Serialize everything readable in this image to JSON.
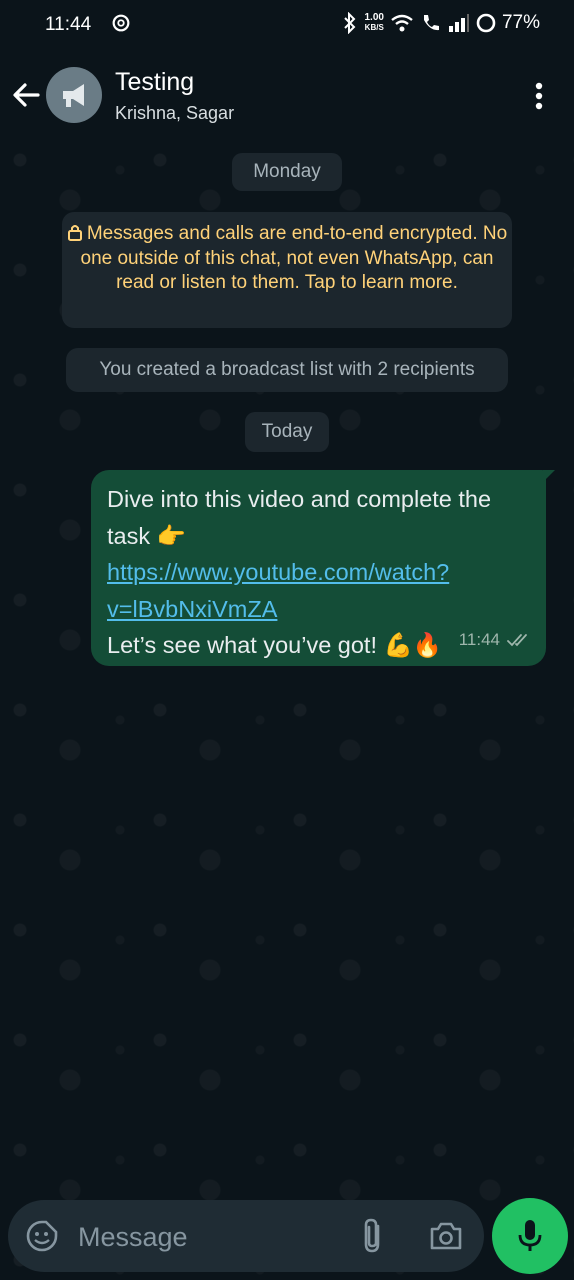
{
  "status_bar": {
    "time": "11:44",
    "speed_value": "1.00",
    "speed_unit": "KB/S",
    "battery": "77%",
    "icons": [
      "app-notification-icon",
      "bluetooth-icon",
      "wifi-icon",
      "wifi-calling-icon",
      "signal-icon",
      "battery-icon"
    ]
  },
  "header": {
    "title": "Testing",
    "subtitle": "Krishna, Sagar",
    "avatar_icon": "broadcast-megaphone-icon"
  },
  "chat": {
    "date_monday": "Monday",
    "encryption_notice": "Messages and calls are end-to-end encrypted. No one outside of this chat, not even WhatsApp, can read or listen to them. Tap to learn more.",
    "broadcast_notice": "You created a broadcast list with 2 recipients",
    "date_today": "Today",
    "message": {
      "text_part1": "Dive into this video and complete the task 👉 ",
      "link": "https://www.youtube.com/watch?v=lBvbNxiVmZA",
      "text_part2": "Let’s see what you’ve got! 💪🔥",
      "time": "11:44",
      "status": "read-double-check"
    }
  },
  "composer": {
    "placeholder": "Message"
  },
  "colors": {
    "background": "#0b141a",
    "bubble_out": "#144d37",
    "system_bubble": "#1c262d",
    "encryption_text": "#ffd279",
    "link": "#53bdeb",
    "accent_green": "#21c063"
  }
}
